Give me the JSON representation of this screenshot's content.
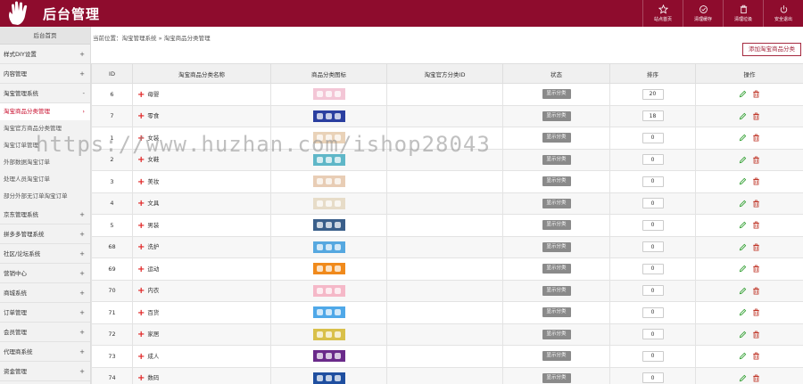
{
  "app": {
    "title": "后台管理"
  },
  "header_buttons": [
    {
      "label": "站点首页",
      "icon": "star-icon"
    },
    {
      "label": "清理缓存",
      "icon": "refresh-icon"
    },
    {
      "label": "清理垃圾",
      "icon": "trash-icon"
    },
    {
      "label": "安全退出",
      "icon": "power-icon"
    }
  ],
  "sidebar": {
    "home": "后台首页",
    "groups_top": [
      {
        "label": "样式DIY设置",
        "sign": "+"
      },
      {
        "label": "内容管理",
        "sign": "+"
      },
      {
        "label": "淘宝管理系统",
        "sign": "-"
      }
    ],
    "subitems": [
      {
        "label": "淘宝商品分类管理",
        "sign": "›",
        "active": true
      },
      {
        "label": "淘宝官方商品分类管理",
        "sign": "",
        "active": false
      },
      {
        "label": "淘宝订单管理",
        "sign": "",
        "active": false
      },
      {
        "label": "外部数据淘宝订单",
        "sign": "",
        "active": false
      },
      {
        "label": "处理人员淘宝订单",
        "sign": "",
        "active": false
      },
      {
        "label": "部分外部无订单淘宝订单",
        "sign": "",
        "active": false
      }
    ],
    "groups_bottom": [
      {
        "label": "京东管理系统",
        "sign": "+"
      },
      {
        "label": "拼多多管理系统",
        "sign": "+"
      },
      {
        "label": "社区/论坛系统",
        "sign": "+"
      },
      {
        "label": "营销中心",
        "sign": "+"
      },
      {
        "label": "商城系统",
        "sign": "+"
      },
      {
        "label": "订单管理",
        "sign": "+"
      },
      {
        "label": "会员管理",
        "sign": "+"
      },
      {
        "label": "代理商系统",
        "sign": "+"
      },
      {
        "label": "资金管理",
        "sign": "+"
      }
    ]
  },
  "breadcrumb": "当前位置：淘宝管理系统 » 淘宝商品分类管理",
  "add_button": "添加淘宝商品分类",
  "table": {
    "headers": [
      "ID",
      "淘宝商品分类名称",
      "商品分类图标",
      "淘宝官方分类ID",
      "状态",
      "排序",
      "操作"
    ],
    "rows": [
      {
        "id": "6",
        "name": "母婴",
        "status": "显示分类",
        "sort": "20",
        "thumb_color": "#f3c6d6"
      },
      {
        "id": "7",
        "name": "零食",
        "status": "显示分类",
        "sort": "18",
        "thumb_color": "#2b3fa0"
      },
      {
        "id": "1",
        "name": "女装",
        "status": "显示分类",
        "sort": "0",
        "thumb_color": "#e9d2b8"
      },
      {
        "id": "2",
        "name": "女鞋",
        "status": "显示分类",
        "sort": "0",
        "thumb_color": "#5fb7c8"
      },
      {
        "id": "3",
        "name": "美妆",
        "status": "显示分类",
        "sort": "0",
        "thumb_color": "#e8cdb5"
      },
      {
        "id": "4",
        "name": "文具",
        "status": "显示分类",
        "sort": "0",
        "thumb_color": "#e7dcc8"
      },
      {
        "id": "5",
        "name": "男装",
        "status": "显示分类",
        "sort": "0",
        "thumb_color": "#3a5f8a"
      },
      {
        "id": "68",
        "name": "洗护",
        "status": "显示分类",
        "sort": "0",
        "thumb_color": "#56a8e0"
      },
      {
        "id": "69",
        "name": "运动",
        "status": "显示分类",
        "sort": "0",
        "thumb_color": "#f08a1c"
      },
      {
        "id": "70",
        "name": "内衣",
        "status": "显示分类",
        "sort": "0",
        "thumb_color": "#f5b8c8"
      },
      {
        "id": "71",
        "name": "百货",
        "status": "显示分类",
        "sort": "0",
        "thumb_color": "#4fa8e8"
      },
      {
        "id": "72",
        "name": "家居",
        "status": "显示分类",
        "sort": "0",
        "thumb_color": "#d9c04a"
      },
      {
        "id": "73",
        "name": "成人",
        "status": "显示分类",
        "sort": "0",
        "thumb_color": "#6a2a8a"
      },
      {
        "id": "74",
        "name": "数码",
        "status": "显示分类",
        "sort": "0",
        "thumb_color": "#1f4fa0"
      }
    ]
  },
  "watermark": "https://www.huzhan.com/ishop28043",
  "colors": {
    "brand": "#8e0c2d",
    "active": "#c9102f",
    "add": "#e02020",
    "edit": "#2e9e2e",
    "delete": "#c0392b"
  }
}
